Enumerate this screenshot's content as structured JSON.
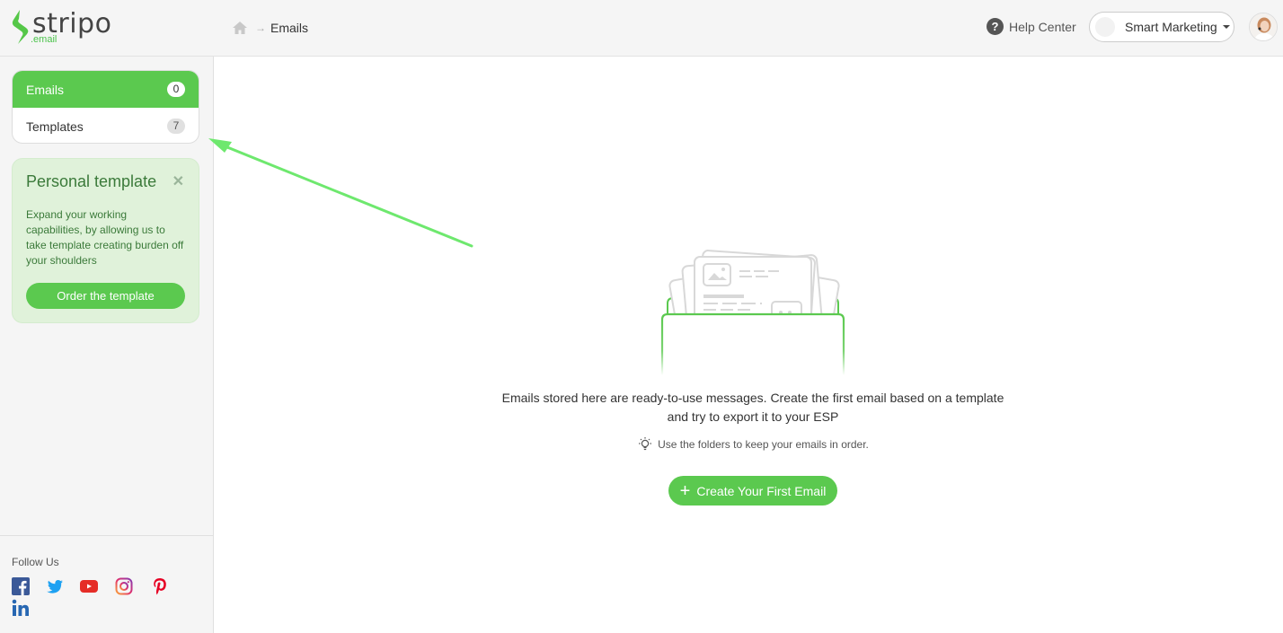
{
  "header": {
    "logo_text": "stripo",
    "logo_sub": ".email",
    "breadcrumb": {
      "home_icon": "home-icon",
      "separator_icon": "arrow-right-icon",
      "current": "Emails"
    },
    "help_label": "Help Center",
    "org_selector": "Smart Marketing",
    "avatar_icon": "user-avatar"
  },
  "sidebar": {
    "nav": [
      {
        "label": "Emails",
        "count": "0",
        "active": true
      },
      {
        "label": "Templates",
        "count": "7",
        "active": false
      }
    ],
    "promo": {
      "title": "Personal template",
      "text": "Expand your working capabilities, by allowing us to take template creating burden off your shoulders",
      "button": "Order the template",
      "close_icon": "close-icon"
    },
    "follow": {
      "label": "Follow Us",
      "networks": [
        "facebook",
        "twitter",
        "youtube",
        "instagram",
        "pinterest",
        "linkedin"
      ]
    }
  },
  "main": {
    "illustration": "email-folder-illustration",
    "empty_line1": "Emails stored here are ready-to-use messages. Create the first email based on a template",
    "empty_line2": "and try to export it to your ESP",
    "tip_icon": "lightbulb-icon",
    "tip": "Use the folders to keep your emails in order.",
    "create_button": "Create Your First Email"
  },
  "colors": {
    "brand_green": "#5bc94f",
    "promo_bg": "#e0f2da",
    "promo_text": "#3b7a3a",
    "annotation_arrow": "#6ee86e"
  }
}
